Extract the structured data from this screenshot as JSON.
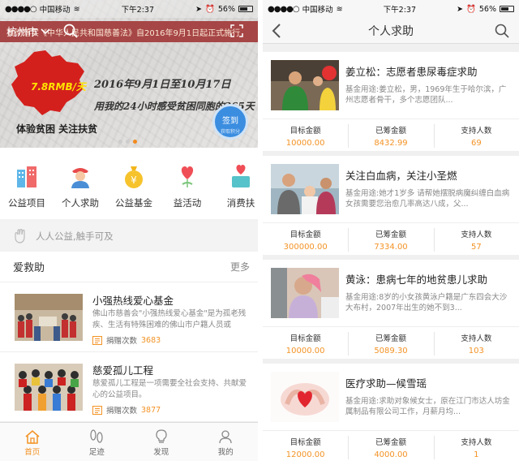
{
  "status_left": {
    "carrier": "中国移动",
    "time": "下午2:37",
    "battery": "56%"
  },
  "status_right": {
    "carrier": "中国移动",
    "time": "下午2:37",
    "battery": "56%"
  },
  "home": {
    "city": "杭州市",
    "ticker": "贯彻落实《中华人民共和国慈善法》自2016年9月1日起正式施行",
    "banner": {
      "price": "7.8RMB/天",
      "line1": "2016年9月1日至10月17日",
      "line2": "用我的24小时感受贫困同胞的365天",
      "line3": "体验贫困  关注扶贫",
      "sign_label": "签到",
      "sign_sub": "获取积分"
    },
    "categories": [
      {
        "label": "公益项目",
        "icon": "buildings-icon"
      },
      {
        "label": "个人求助",
        "icon": "person-icon"
      },
      {
        "label": "公益基金",
        "icon": "money-bag-icon"
      },
      {
        "label": "益活动",
        "icon": "heart-balloon-icon"
      },
      {
        "label": "消费扶",
        "icon": "heart-box-icon"
      }
    ],
    "slogan": "人人公益,触手可及",
    "section_title": "爱救助",
    "section_more": "更多",
    "funds": [
      {
        "title": "小强热线爱心基金",
        "desc": "佛山市慈善会\"小强热线爱心基金\"是为孤老残疾、生活有特殊困难的佛山市户籍人员或",
        "count_label": "捐赠次数",
        "count": "3683"
      },
      {
        "title": "慈爱孤儿工程",
        "desc": "慈爱孤儿工程是一项需要全社会支持、共献爱心的公益项目。",
        "count_label": "捐赠次数",
        "count": "3877"
      }
    ],
    "tabs": [
      {
        "label": "首页",
        "icon": "home-icon"
      },
      {
        "label": "足迹",
        "icon": "footprint-icon"
      },
      {
        "label": "发现",
        "icon": "bulb-icon"
      },
      {
        "label": "我的",
        "icon": "user-icon"
      }
    ]
  },
  "help": {
    "title": "个人求助",
    "stat_labels": [
      "目标金额",
      "已筹金额",
      "支持人数"
    ],
    "cases": [
      {
        "title": "姜立松：志愿者患尿毒症求助",
        "desc": "基金用途:姜立松，男，1969年生于哈尔滨，广州志愿者骨干，多个志愿团队...",
        "target": "10000.00",
        "raised": "8432.99",
        "supporters": "69"
      },
      {
        "title": "关注白血病，关注小圣燃",
        "desc": "基金用途:她才1岁多 请帮她摆脱病魔纠缠白血病女孩需要您治愈几率高达八成，父...",
        "target": "300000.00",
        "raised": "7334.00",
        "supporters": "57"
      },
      {
        "title": "黄泳：患病七年的地贫患儿求助",
        "desc": "基金用途:8岁的小女孩黄泳户籍是广东四会大沙大布村，2007年出生的她不到3...",
        "target": "10000.00",
        "raised": "5089.30",
        "supporters": "103"
      },
      {
        "title": "医疗求助—候雪瑶",
        "desc": "基金用途:求助对象候女士，原在江门市达人坊金属制品有限公司工作，月薪月均...",
        "target": "12000.00",
        "raised": "4000.00",
        "supporters": "1"
      }
    ]
  }
}
